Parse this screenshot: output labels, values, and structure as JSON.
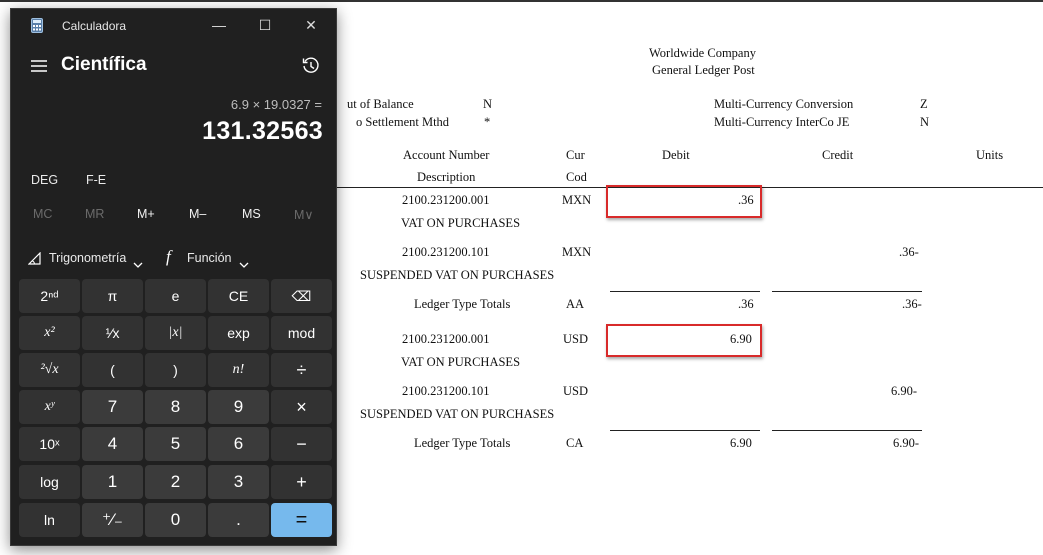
{
  "report": {
    "company": "Worldwide Company",
    "report_title": "General Ledger Post",
    "fields": [
      {
        "label": "ut of Balance",
        "value": "N"
      },
      {
        "label": "o Settlement Mthd",
        "value": "*"
      },
      {
        "label": "Multi-Currency Conversion",
        "value": "Z"
      },
      {
        "label": "Multi-Currency InterCo JE",
        "value": "N"
      }
    ],
    "columns": {
      "account_number": "Account Number",
      "description": "Description",
      "cur": "Cur",
      "cod": "Cod",
      "debit": "Debit",
      "credit": "Credit",
      "units": "Units"
    },
    "rows": [
      {
        "account": "2100.231200.001",
        "cur": "MXN",
        "debit": ".36",
        "desc": "VAT ON PURCHASES"
      },
      {
        "account": "2100.231200.101",
        "cur": "MXN",
        "credit": ".36-",
        "desc": "SUSPENDED VAT ON PURCHASES"
      },
      {
        "label": "Ledger Type Totals",
        "code": "AA",
        "debit": ".36",
        "credit": ".36-"
      },
      {
        "account": "2100.231200.001",
        "cur": "USD",
        "debit": "6.90",
        "desc": "VAT ON PURCHASES"
      },
      {
        "account": "2100.231200.101",
        "cur": "USD",
        "credit": "6.90-",
        "desc": "SUSPENDED VAT ON PURCHASES"
      },
      {
        "label": "Ledger Type Totals",
        "code": "CA",
        "debit": "6.90",
        "credit": "6.90-"
      }
    ],
    "highlight_color": "#d82a2a"
  },
  "calculator": {
    "app_title": "Calculadora",
    "window_buttons": {
      "minimize": "—",
      "maximize": "☐",
      "close": "✕"
    },
    "mode": "Científica",
    "expression": "6.9 × 19.0327 =",
    "display": "131.32563",
    "angle_mode": "DEG",
    "fe": "F-E",
    "memory": [
      "MC",
      "MR",
      "M+",
      "M–",
      "MS",
      "M∨"
    ],
    "trig_label": "Trigonometría",
    "func_label": "Función",
    "keys": [
      [
        "2ⁿᵈ",
        "π",
        "e",
        "CE",
        "⌫"
      ],
      [
        "x²",
        "¹⁄x",
        "|x|",
        "exp",
        "mod"
      ],
      [
        "²√x",
        "(",
        ")",
        "n!",
        "÷"
      ],
      [
        "xʸ",
        "7",
        "8",
        "9",
        "×"
      ],
      [
        "10ˣ",
        "4",
        "5",
        "6",
        "−"
      ],
      [
        "log",
        "1",
        "2",
        "3",
        "+"
      ],
      [
        "ln",
        "⁺⁄₋",
        "0",
        ".",
        "="
      ]
    ],
    "accent_color": "#76b9ed"
  }
}
